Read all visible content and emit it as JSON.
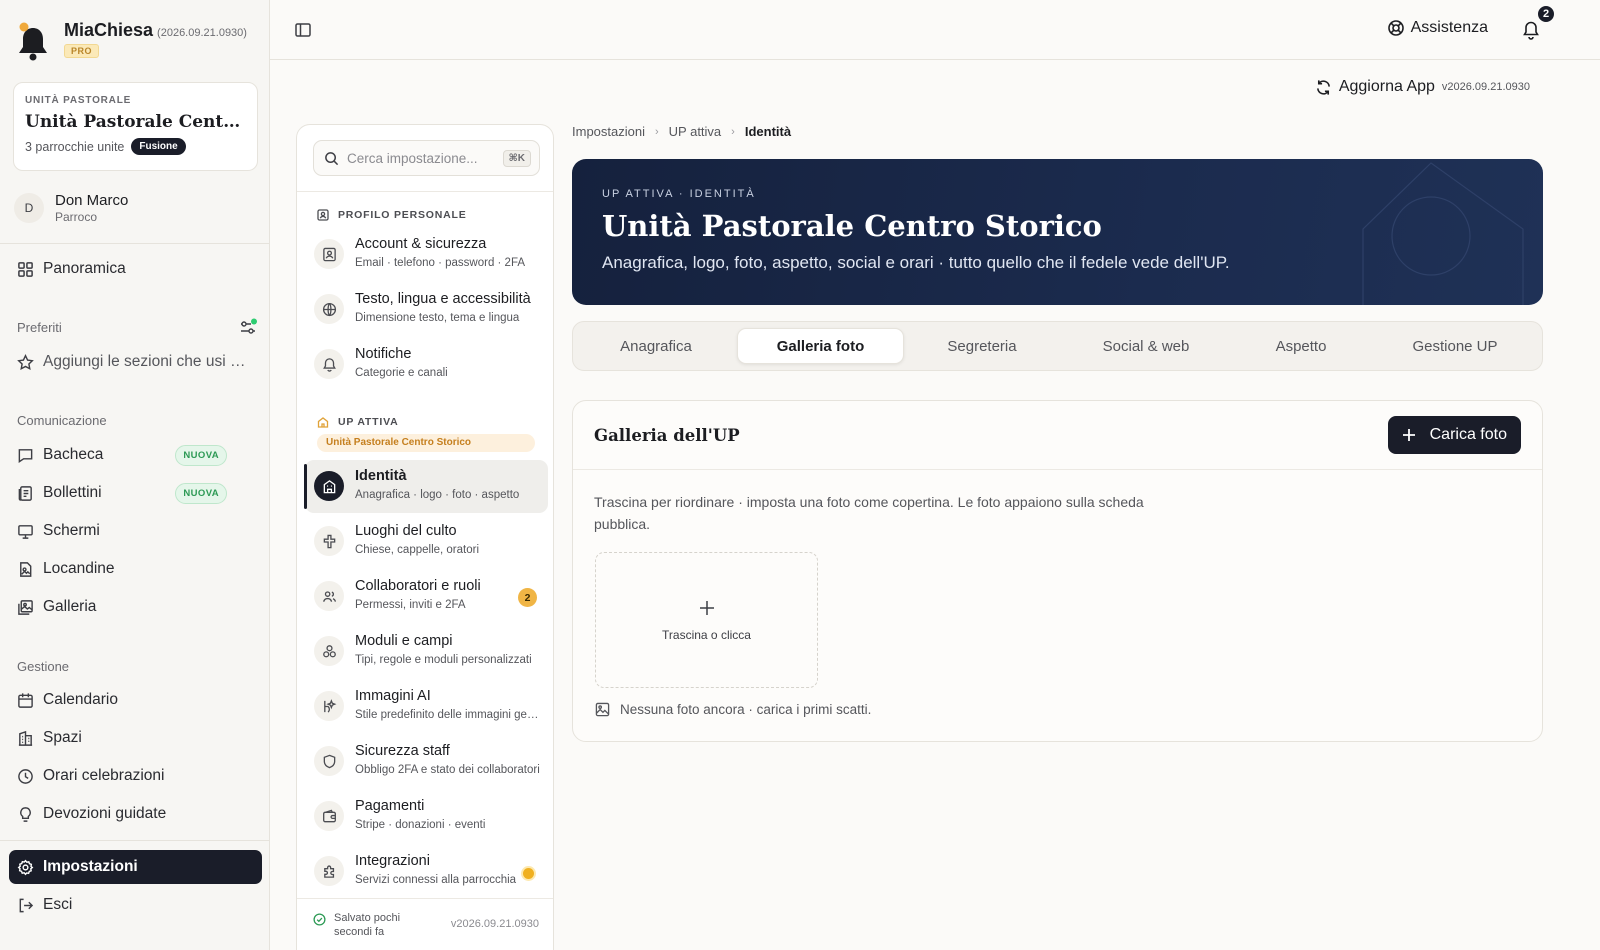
{
  "app": {
    "name": "MiaChiesa",
    "version": "(2026.09.21.0930)",
    "plan_badge": "PRO"
  },
  "up_card": {
    "kicker": "UNITÀ PASTORALE",
    "title": "Unità Pastorale Centro Storico",
    "subtitle": "3 parrocchie unite",
    "badge": "Fusione"
  },
  "user": {
    "initial": "D",
    "name": "Don Marco",
    "role": "Parroco"
  },
  "nav": {
    "overview": "Panoramica",
    "favorites_title": "Preferiti",
    "favorites_placeholder": "Aggiungi le sezioni che usi di più",
    "communication_title": "Comunicazione",
    "communication": [
      {
        "label": "Bacheca",
        "badge": "NUOVA"
      },
      {
        "label": "Bollettini",
        "badge": "NUOVA"
      },
      {
        "label": "Schermi"
      },
      {
        "label": "Locandine"
      },
      {
        "label": "Galleria"
      }
    ],
    "management_title": "Gestione",
    "management": [
      {
        "label": "Calendario"
      },
      {
        "label": "Spazi"
      },
      {
        "label": "Orari celebrazioni"
      },
      {
        "label": "Devozioni guidate"
      }
    ],
    "settings": "Impostazioni",
    "logout": "Esci"
  },
  "topbar": {
    "help": "Assistenza",
    "notification_count": "2",
    "update": "Aggiorna App",
    "update_version": "v2026.09.21.0930"
  },
  "settings_panel": {
    "search_placeholder": "Cerca impostazione...",
    "search_shortcut": "⌘K",
    "personal_group": "PROFILO PERSONALE",
    "personal_items": [
      {
        "title": "Account & sicurezza",
        "sub": "Email · telefono · password · 2FA"
      },
      {
        "title": "Testo, lingua e accessibilità",
        "sub": "Dimensione testo, tema e lingua"
      },
      {
        "title": "Notifiche",
        "sub": "Categorie e canali"
      }
    ],
    "up_group": "UP ATTIVA",
    "up_chip": "Unità Pastorale Centro Storico",
    "up_items": [
      {
        "title": "Identità",
        "sub": "Anagrafica · logo · foto · aspetto"
      },
      {
        "title": "Luoghi del culto",
        "sub": "Chiese, cappelle, oratori"
      },
      {
        "title": "Collaboratori e ruoli",
        "sub": "Permessi, inviti e 2FA",
        "count": "2"
      },
      {
        "title": "Moduli e campi",
        "sub": "Tipi, regole e moduli personalizzati"
      },
      {
        "title": "Immagini AI",
        "sub": "Stile predefinito delle immagini generate"
      },
      {
        "title": "Sicurezza staff",
        "sub": "Obbligo 2FA e stato dei collaboratori"
      },
      {
        "title": "Pagamenti",
        "sub": "Stripe · donazioni · eventi"
      },
      {
        "title": "Integrazioni",
        "sub": "Servizi connessi alla parrocchia"
      }
    ],
    "saved_status": "Salvato pochi secondi fa",
    "version": "v2026.09.21.0930"
  },
  "breadcrumb": [
    "Impostazioni",
    "UP attiva",
    "Identità"
  ],
  "hero": {
    "kicker": "UP ATTIVA · IDENTITÀ",
    "title": "Unità Pastorale Centro Storico",
    "subtitle": "Anagrafica, logo, foto, aspetto, social e orari · tutto quello che il fedele vede dell'UP."
  },
  "tabs": [
    "Anagrafica",
    "Galleria foto",
    "Segreteria",
    "Social & web",
    "Aspetto",
    "Gestione UP"
  ],
  "gallery": {
    "title": "Galleria dell'UP",
    "upload_label": "Carica foto",
    "help": "Trascina per riordinare · imposta una foto come copertina. Le foto appaiono sulla scheda pubblica.",
    "dropzone_label": "Trascina o clicca",
    "empty": "Nessuna foto ancora · carica i primi scatti."
  },
  "colors": {
    "navy": "#1a1d29",
    "hero_bg": "#1b2b4e",
    "new_badge": "#2d9a55",
    "pro_badge": "#b9862a",
    "count_badge": "#f0b545"
  },
  "icons": {
    "brand": "bell-icon",
    "panel": "sidebar-panel-icon",
    "help": "lifebuoy-icon",
    "notifications": "bell-icon",
    "update": "refresh-icon",
    "search": "search-icon"
  }
}
